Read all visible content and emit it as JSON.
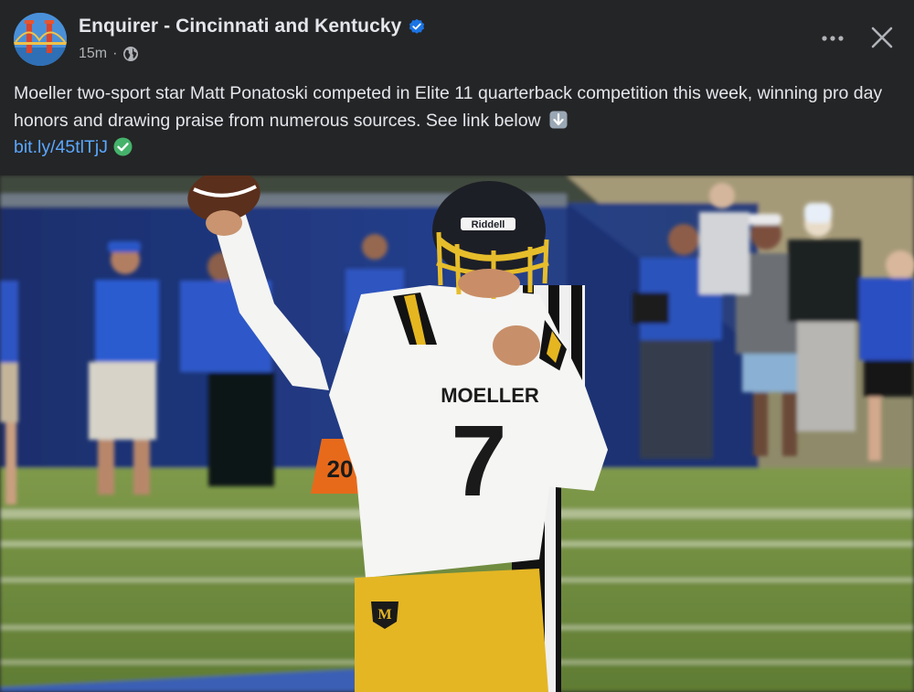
{
  "post": {
    "page_name": "Enquirer - Cincinnati and Kentucky",
    "timestamp": "15m",
    "separator": "·",
    "text_main": "Moeller two-sport star Matt Ponatoski competed in Elite 11 quarterback competition this week, winning pro day honors and drawing praise from numerous sources. See link below",
    "link_text": "bit.ly/45tlTjJ"
  },
  "photo": {
    "helmet_brand": "Riddell",
    "jersey_name": "MOELLER",
    "jersey_number": "7",
    "pylon_number": "20",
    "pants_logo": "M"
  },
  "icons": {
    "avatar": "bridge-logo-icon",
    "verified": "verified-badge-icon",
    "privacy": "globe-icon",
    "more": "more-horizontal-icon",
    "close": "close-icon",
    "emoji_arrow": "down-arrow-emoji-icon",
    "emoji_check": "check-mark-emoji-icon"
  },
  "colors": {
    "background": "#242526",
    "text": "#e4e6eb",
    "secondary_text": "#b0b3b8",
    "link": "#5aa7ff",
    "verified": "#1b74e4"
  }
}
